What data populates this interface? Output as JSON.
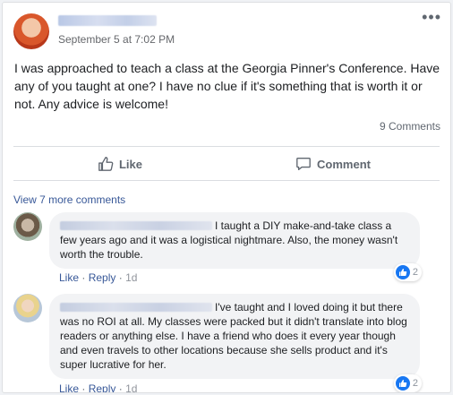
{
  "post": {
    "timestamp": "September 5 at 7:02 PM",
    "body": "I was approached to teach a class at the Georgia Pinner's Conference. Have any of you taught at one? I have no clue if it's something that is worth it or not. Any advice is welcome!",
    "comments_count": "9 Comments",
    "more_icon": "more-options-icon"
  },
  "actions": {
    "like_label": "Like",
    "comment_label": "Comment"
  },
  "comments_section": {
    "view_more": "View 7 more comments",
    "comments": [
      {
        "text": "I taught a DIY make-and-take class a few years ago and it was a logistical nightmare. Also, the money wasn't worth the trouble.",
        "like_link": "Like",
        "reply_link": "Reply",
        "separator": "·",
        "time": "1d",
        "reaction_count": "2"
      },
      {
        "text": "I've taught and I loved doing it but there was no ROI at all. My classes were packed but it didn't translate into blog readers or anything else. I have a friend who does it every year though and even travels to other locations because she sells product and it's super lucrative for her.",
        "like_link": "Like",
        "reply_link": "Reply",
        "separator": "·",
        "time": "1d",
        "reaction_count": "2"
      }
    ]
  },
  "colors": {
    "link": "#385898",
    "like_reaction": "#1877f2",
    "muted": "#606770",
    "bubble": "#f2f3f5"
  }
}
